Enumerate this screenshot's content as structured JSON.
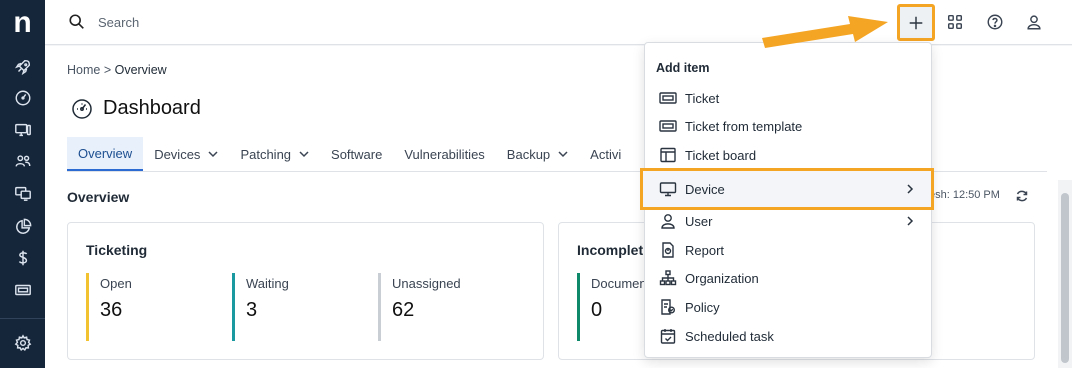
{
  "app": {
    "logo_text": "n"
  },
  "sidebar": {
    "items": [
      {
        "name": "rocket-icon"
      },
      {
        "name": "dashboard-gauge-icon"
      },
      {
        "name": "devices-icon"
      },
      {
        "name": "users-icon"
      },
      {
        "name": "screens-icon"
      },
      {
        "name": "pie-chart-icon"
      },
      {
        "name": "dollar-icon"
      },
      {
        "name": "ticket-icon"
      },
      {
        "name": "settings-gear-icon"
      }
    ]
  },
  "topbar": {
    "search": {
      "placeholder": "Search"
    },
    "icons": [
      "add-icon",
      "apps-grid-icon",
      "help-icon",
      "user-icon"
    ]
  },
  "breadcrumb": {
    "home": "Home",
    "separator": " > ",
    "current": "Overview"
  },
  "page": {
    "title": "Dashboard"
  },
  "tabs": [
    {
      "label": "Overview",
      "active": true,
      "has_dropdown": false
    },
    {
      "label": "Devices",
      "has_dropdown": true
    },
    {
      "label": "Patching",
      "has_dropdown": true
    },
    {
      "label": "Software",
      "has_dropdown": false
    },
    {
      "label": "Vulnerabilities",
      "has_dropdown": false
    },
    {
      "label": "Backup",
      "has_dropdown": true
    },
    {
      "label": "Activi",
      "has_dropdown": false
    }
  ],
  "overview": {
    "section_title": "Overview",
    "refresh_text": "esh: 12:50 PM"
  },
  "cards": {
    "ticketing": {
      "title": "Ticketing",
      "stats": [
        {
          "label": "Open",
          "value": "36",
          "color": "#f2c230"
        },
        {
          "label": "Waiting",
          "value": "3",
          "color": "#1a9aa0"
        },
        {
          "label": "Unassigned",
          "value": "62",
          "color": "#c9ced4"
        }
      ]
    },
    "incomplete": {
      "title": "Incomplet",
      "stats": [
        {
          "label": "Documen",
          "value": "0",
          "color": "#0e8a6a"
        }
      ]
    }
  },
  "add_menu": {
    "header": "Add item",
    "items": [
      {
        "label": "Ticket",
        "icon": "ticket-icon"
      },
      {
        "label": "Ticket from template",
        "icon": "ticket-template-icon"
      },
      {
        "label": "Ticket board",
        "icon": "board-icon"
      },
      {
        "label": "Device",
        "icon": "monitor-icon",
        "submenu": true,
        "highlighted": true
      },
      {
        "label": "User",
        "icon": "person-icon",
        "submenu": true
      },
      {
        "label": "Report",
        "icon": "report-icon"
      },
      {
        "label": "Organization",
        "icon": "organization-icon"
      },
      {
        "label": "Policy",
        "icon": "policy-icon"
      },
      {
        "label": "Scheduled task",
        "icon": "calendar-check-icon"
      }
    ]
  },
  "annotation": {
    "color": "#f5a524"
  }
}
